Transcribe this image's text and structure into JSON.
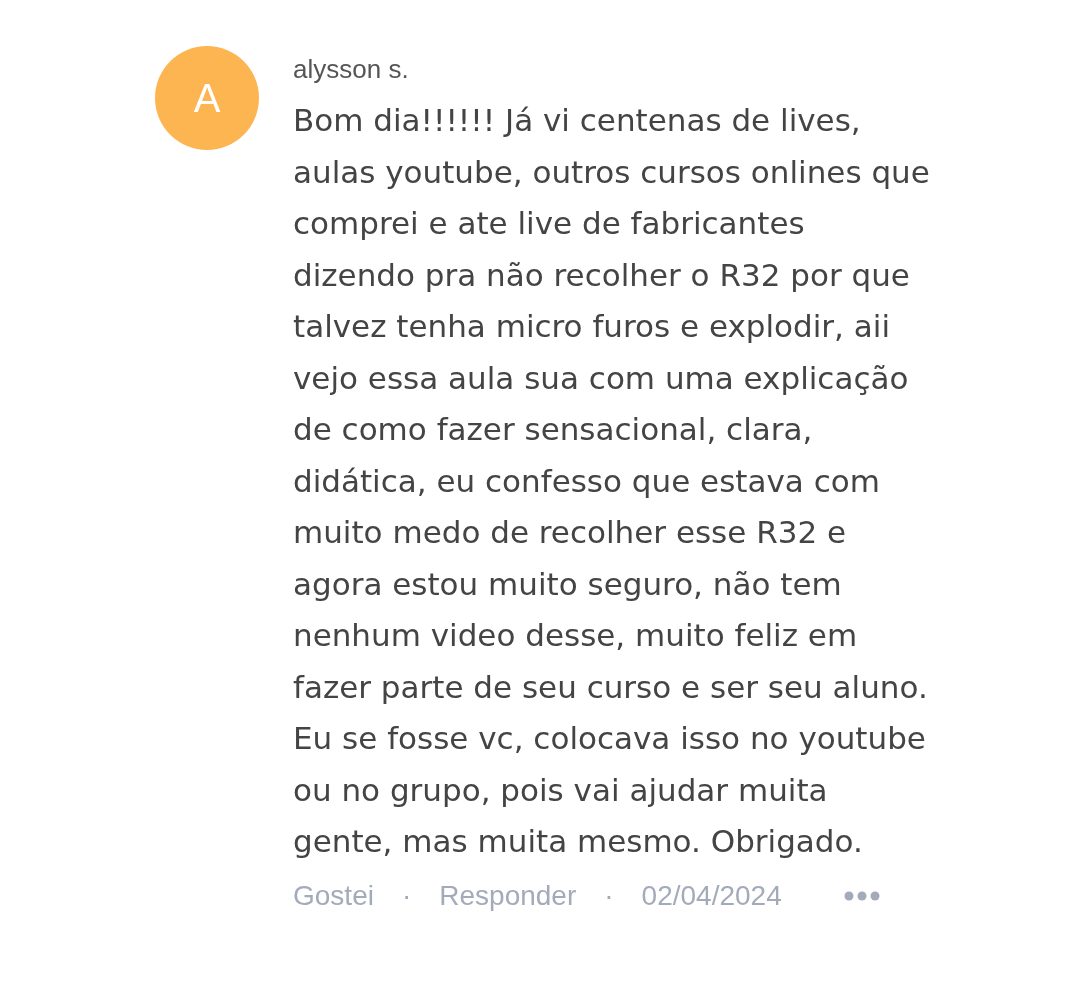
{
  "comment": {
    "avatar_letter": "A",
    "author": "alysson s.",
    "text": "Bom dia!!!!!! Já vi centenas de lives, aulas youtube, outros cursos onlines que comprei e ate live de fabricantes dizendo pra não recolher o R32 por que talvez tenha micro furos e explodir, aii vejo essa aula sua com uma explicação de como fazer sensacional, clara, didática, eu confesso que estava com muito medo de recolher esse R32 e agora estou muito seguro, não tem nenhum video desse, muito feliz em fazer parte de seu curso e ser seu aluno. Eu se fosse vc, colocava isso no youtube ou no grupo, pois vai ajudar muita gente, mas muita mesmo. Obrigado.",
    "actions": [
      {
        "kind": "link",
        "label": "Gostei"
      },
      {
        "kind": "separator",
        "label": "·"
      },
      {
        "kind": "link",
        "label": "Responder"
      },
      {
        "kind": "separator",
        "label": "·"
      },
      {
        "kind": "date",
        "label": "02/04/2024"
      },
      {
        "kind": "more"
      }
    ]
  }
}
